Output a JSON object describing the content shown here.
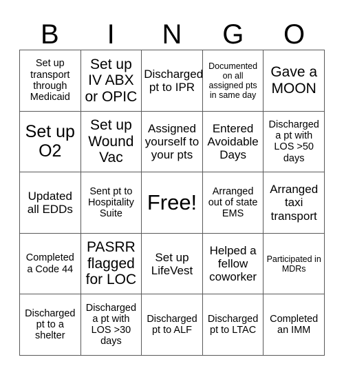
{
  "card": {
    "header_letters": [
      "B",
      "I",
      "N",
      "G",
      "O"
    ],
    "colors": {
      "background": "#ffffff",
      "text": "#000000",
      "grid_line": "#595959"
    },
    "rows": [
      [
        {
          "text": "Set up transport through Medicaid",
          "size": "s"
        },
        {
          "text": "Set up\nIV ABX\nor OPIC",
          "size": "l"
        },
        {
          "text": "Discharged pt to IPR",
          "size": "m"
        },
        {
          "text": "Documented on all assigned pts in same day",
          "size": "xs"
        },
        {
          "text": "Gave a MOON",
          "size": "l"
        }
      ],
      [
        {
          "text": "Set up O2",
          "size": "xl"
        },
        {
          "text": "Set up Wound Vac",
          "size": "l"
        },
        {
          "text": "Assigned yourself to your pts",
          "size": "m"
        },
        {
          "text": "Entered Avoidable Days",
          "size": "m"
        },
        {
          "text": "Discharged a pt with LOS >50 days",
          "size": "s"
        }
      ],
      [
        {
          "text": "Updated all EDDs",
          "size": "m"
        },
        {
          "text": "Sent pt to Hospitality Suite",
          "size": "s"
        },
        {
          "text": "Free!",
          "size": "xxl"
        },
        {
          "text": "Arranged out of state EMS",
          "size": "s"
        },
        {
          "text": "Arranged taxi transport",
          "size": "m"
        }
      ],
      [
        {
          "text": "Completed a Code 44",
          "size": "s"
        },
        {
          "text": "PASRR flagged for LOC",
          "size": "l"
        },
        {
          "text": "Set up LifeVest",
          "size": "m"
        },
        {
          "text": "Helped a fellow coworker",
          "size": "m"
        },
        {
          "text": "Participated in MDRs",
          "size": "xs"
        }
      ],
      [
        {
          "text": "Discharged pt to a shelter",
          "size": "s"
        },
        {
          "text": "Discharged a pt with LOS >30 days",
          "size": "s"
        },
        {
          "text": "Discharged pt to ALF",
          "size": "s"
        },
        {
          "text": "Discharged pt to LTAC",
          "size": "s"
        },
        {
          "text": "Completed an IMM",
          "size": "s"
        }
      ]
    ]
  }
}
